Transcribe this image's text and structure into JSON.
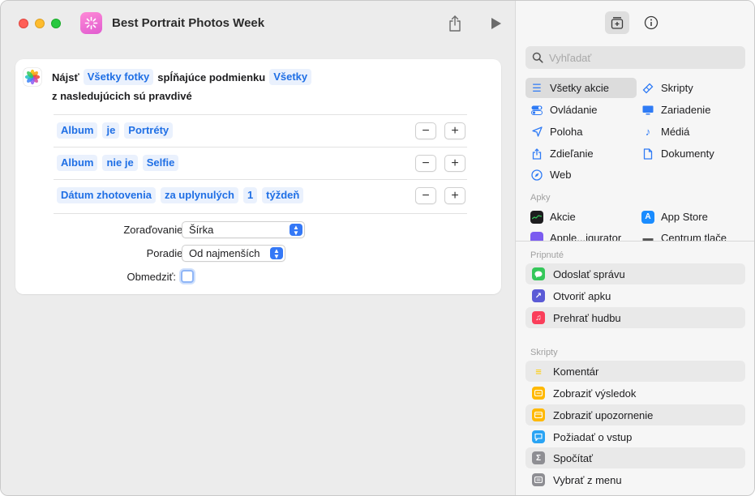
{
  "window": {
    "title": "Best Portrait Photos Week"
  },
  "action": {
    "find": "Nájsť",
    "source": "Všetky fotky",
    "matching": "spĺňajúce podmienku",
    "mode": "Všetky",
    "following": "z nasledujúcich sú pravdivé",
    "conditions": [
      {
        "tokens": [
          "Album",
          "je",
          "Portréty"
        ]
      },
      {
        "tokens": [
          "Album",
          "nie je",
          "Selfie"
        ]
      },
      {
        "tokens": [
          "Dátum zhotovenia",
          "za uplynulých",
          "1",
          "týždeň"
        ]
      }
    ],
    "minus_label": "−",
    "plus_label": "+",
    "sort_label": "Zoraďovanie:",
    "sort_value": "Šírka",
    "order_label": "Poradie:",
    "order_value": "Od najmenších",
    "limit_label": "Obmedziť:"
  },
  "library": {
    "search_placeholder": "Vyhľadať",
    "categories_left": [
      "Všetky akcie",
      "Ovládanie",
      "Poloha",
      "Zdieľanie",
      "Web"
    ],
    "categories_right": [
      "Skripty",
      "Zariadenie",
      "Médiá",
      "Dokumenty"
    ],
    "apps_label": "Apky",
    "apps": [
      "Akcie",
      "App Store",
      "Apple...igurator",
      "Centrum tlače"
    ],
    "pinned_label": "Pripnuté",
    "pinned": [
      "Odoslať správu",
      "Otvoriť apku",
      "Prehrať hudbu"
    ],
    "scripts_label": "Skripty",
    "scripts": [
      "Komentár",
      "Zobraziť výsledok",
      "Zobraziť upozornenie",
      "Požiadať o vstup",
      "Spočítať",
      "Vybrať z menu"
    ]
  },
  "colors": {
    "accent": "#1f6fe5",
    "token_bg": "#eaf1fd",
    "message_green": "#34c759",
    "open_app_purple": "#5b5bd6",
    "music_red": "#fa3e5a",
    "comment_yellow": "#ffd60a",
    "result_orange": "#ffb900",
    "alert_orange": "#ffb900",
    "ask_blue": "#2aa4f4",
    "count_gray": "#8e8e93"
  }
}
